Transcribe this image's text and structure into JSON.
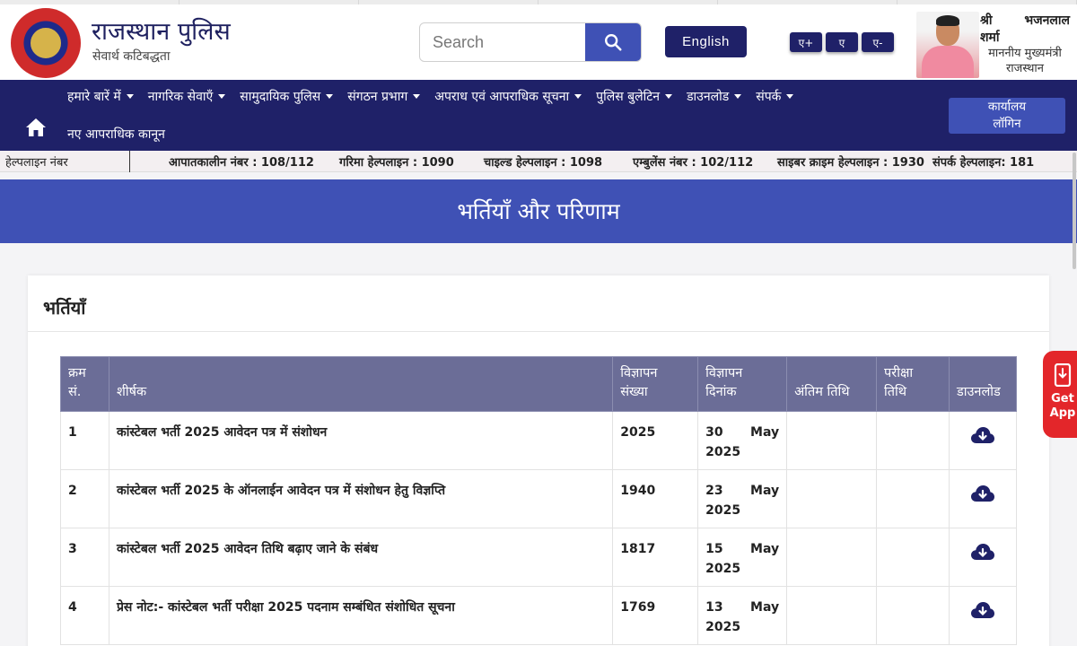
{
  "header": {
    "site_title": "राजस्थान पुलिस",
    "tagline": "सेवार्थ कटिबद्धता",
    "search_placeholder": "Search",
    "language_button": "English",
    "font_increase": "ए+",
    "font_normal": "ए",
    "font_decrease": "ए-",
    "cm": {
      "name_part1": "श्री",
      "name_part2": "भजनलाल",
      "name_part3": "शर्मा",
      "title_line1": "माननीय मुख्यमंत्री",
      "title_line2": "राजस्थान"
    }
  },
  "nav": {
    "items": [
      {
        "label": "हमारे बारें में"
      },
      {
        "label": "नागरिक सेवाएँ"
      },
      {
        "label": "सामुदायिक पुलिस"
      },
      {
        "label": "संगठन प्रभाग"
      },
      {
        "label": "अपराध एवं आपराधिक सूचना"
      },
      {
        "label": "पुलिस बुलेटिन"
      },
      {
        "label": "डाउनलोड"
      },
      {
        "label": "संपर्क"
      }
    ],
    "second_row": "नए आपराधिक कानून",
    "login_line1": "कार्यालय",
    "login_line2": "लॉगिन"
  },
  "helpline": {
    "label": "हेल्पलाइन नंबर",
    "items": [
      "आपातकालीन नंबर : 108/112",
      "गरिमा हेल्पलाइन : 1090",
      "चाइल्ड हेल्पलाइन : 1098",
      "एम्बुलेंस नंबर : 102/112",
      "साइबर क्राइम हेल्पलाइन : 1930",
      "संपर्क हेल्पलाइन: 181"
    ]
  },
  "banner": {
    "title": "भर्तियाँ और परिणाम"
  },
  "card": {
    "title": "भर्तियाँ"
  },
  "table": {
    "headers": {
      "sno_line1": "क्रम",
      "sno_line2": "सं.",
      "title": "शीर्षक",
      "adv_no_line1": "विज्ञापन",
      "adv_no_line2": "संख्या",
      "adv_date_line1": "विज्ञापन",
      "adv_date_line2": "दिनांक",
      "last_date": "अंतिम तिथि",
      "exam_date_line1": "परीक्षा",
      "exam_date_line2": "तिथि",
      "download": "डाउनलोड"
    },
    "rows": [
      {
        "sno": "1",
        "title": "कांस्टेबल भर्ती 2025 आवेदन पत्र में संशोधन",
        "adv_no": "2025",
        "day": "30",
        "month": "May",
        "year": "2025",
        "last_date": "",
        "exam_date": ""
      },
      {
        "sno": "2",
        "title": "कांस्टेबल भर्ती 2025 के ऑनलाईन आवेदन पत्र में संशोधन हेतु विज्ञप्ति",
        "adv_no": "1940",
        "day": "23",
        "month": "May",
        "year": "2025",
        "last_date": "",
        "exam_date": ""
      },
      {
        "sno": "3",
        "title": "कांस्टेबल भर्ती 2025 आवेदन तिथि बढ़ाए जाने के संबंध",
        "adv_no": "1817",
        "day": "15",
        "month": "May",
        "year": "2025",
        "last_date": "",
        "exam_date": ""
      },
      {
        "sno": "4",
        "title": "प्रेस नोट:- कांस्टेबल भर्ती परीक्षा 2025 पदनाम सम्बंधित संशोधित सूचना",
        "adv_no": "1769",
        "day": "13",
        "month": "May",
        "year": "2025",
        "last_date": "",
        "exam_date": ""
      }
    ]
  },
  "get_app": {
    "line1": "Get",
    "line2": "App"
  },
  "colors": {
    "nav_bg": "#1f2168",
    "accent": "#3f51b5",
    "table_header": "#6b6d97",
    "get_app": "#e3262a"
  },
  "icons": {
    "search": "search-icon",
    "home": "home-icon",
    "download": "cloud-download-icon",
    "mobile": "mobile-download-icon"
  }
}
